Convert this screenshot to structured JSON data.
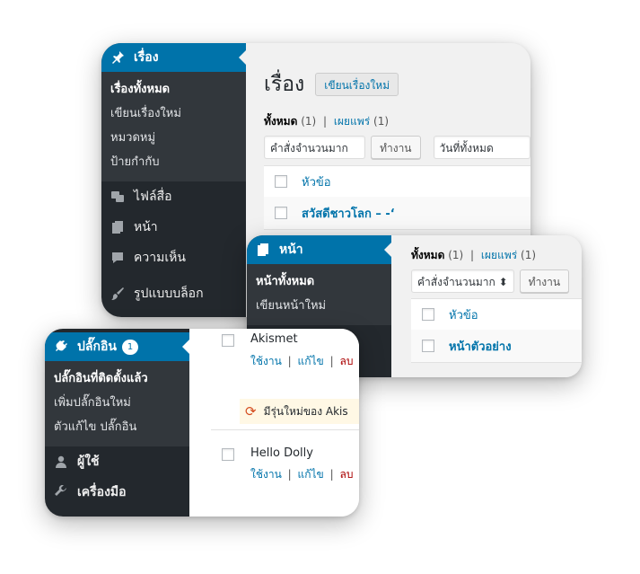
{
  "posts_window": {
    "menu_active": "เรื่อง",
    "submenu": [
      "เรื่องทั้งหมด",
      "เขียนเรื่องใหม่",
      "หมวดหมู่",
      "ป้ายกำกับ"
    ],
    "menu_items": [
      "ไฟล์สื่อ",
      "หน้า",
      "ความเห็น",
      "รูปแบบบล็อก"
    ],
    "page_title": "เรื่อง",
    "add_new": "เขียนเรื่องใหม่",
    "filter_all": "ทั้งหมด",
    "filter_all_count": "(1)",
    "filter_sep": "|",
    "filter_published": "เผยแพร่",
    "filter_published_count": "(1)",
    "bulk_select": "คำสั่งจำนวนมาก ⬍",
    "apply": "ทำงาน",
    "date_select": "วันที่ทั้งหมด",
    "col_title": "หัวข้อ",
    "row_title": "สวัสดีชาวโลก – -‘"
  },
  "pages_window": {
    "menu_active": "หน้า",
    "submenu": [
      "หน้าทั้งหมด",
      "เขียนหน้าใหม่"
    ],
    "filter_all": "ทั้งหมด",
    "filter_all_count": "(1)",
    "filter_sep": "|",
    "filter_published": "เผยแพร่",
    "filter_published_count": "(1)",
    "bulk_select": "คำสั่งจำนวนมาก ⬍",
    "apply": "ทำงาน",
    "col_title": "หัวข้อ",
    "row_title": "หน้าตัวอย่าง"
  },
  "plugins_window": {
    "menu_active": "ปลั๊กอิน",
    "badge": "1",
    "submenu": [
      "ปลั๊กอินที่ติดตั้งแล้ว",
      "เพิ่มปลั๊กอินใหม่",
      "ตัวแก้ไข ปลั๊กอิน"
    ],
    "menu_items": [
      "ผู้ใช้",
      "เครื่องมือ"
    ],
    "plugins": [
      {
        "name": "Akismet",
        "activate": "ใช้งาน",
        "edit": "แก้ไข",
        "delete": "ลบ",
        "sep1": "|",
        "sep2": "|"
      },
      {
        "name": "Hello Dolly",
        "activate": "ใช้งาน",
        "edit": "แก้ไข",
        "delete": "ลบ",
        "sep1": "|",
        "sep2": "|"
      }
    ],
    "update_notice": "มีรุ่นใหม่ของ Akis"
  },
  "colors": {
    "sidebar": "#23282d",
    "submenu": "#32373c",
    "accent": "#0073aa",
    "link": "#0073aa",
    "badge": "#d54e21"
  }
}
